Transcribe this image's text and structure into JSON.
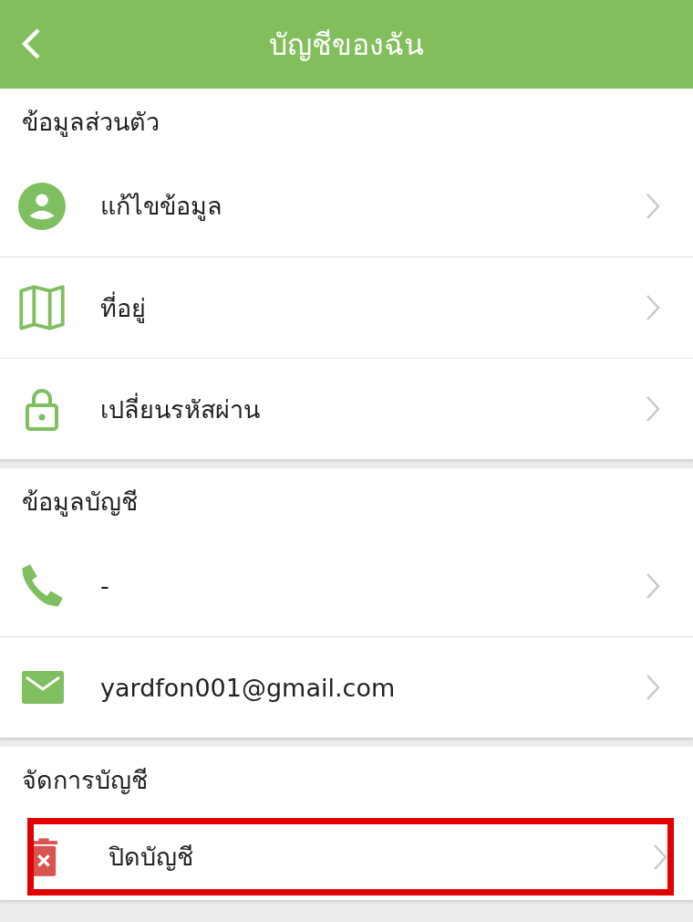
{
  "header": {
    "title": "บัญชีของฉัน"
  },
  "sections": [
    {
      "title": "ข้อมูลส่วนตัว",
      "items": [
        {
          "kind": "person",
          "label": "แก้ไขข้อมูล",
          "highlighted": false
        },
        {
          "kind": "map",
          "label": "ที่อยู่",
          "highlighted": false
        },
        {
          "kind": "lock",
          "label": "เปลี่ยนรหัสผ่าน",
          "highlighted": false
        }
      ]
    },
    {
      "title": "ข้อมูลบัญชี",
      "items": [
        {
          "kind": "phone",
          "label": "-",
          "highlighted": false
        },
        {
          "kind": "mail",
          "label": "yardfon001@gmail.com",
          "highlighted": false
        }
      ]
    },
    {
      "title": "จัดการบัญชี",
      "items": [
        {
          "kind": "trash",
          "label": "ปิดบัญชี",
          "highlighted": true
        }
      ]
    }
  ]
}
